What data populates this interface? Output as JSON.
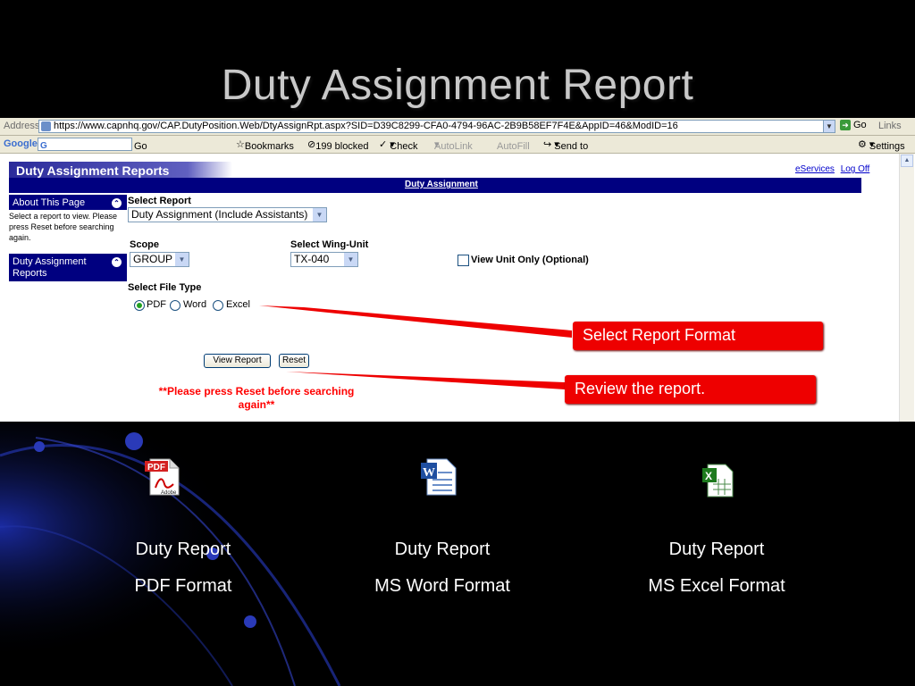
{
  "slide": {
    "title": "Duty Assignment Report"
  },
  "browser": {
    "address_label": "Address",
    "url": "https://www.capnhq.gov/CAP.DutyPosition.Web/DtyAssignRpt.aspx?SID=D39C8299-CFA0-4794-96AC-2B9B58EF7F4E&AppID=46&ModID=16",
    "go_label": "Go",
    "links_label": "Links",
    "google_label": "Google",
    "go_small": "Go",
    "bookmarks": "Bookmarks",
    "blocked": "199 blocked",
    "check": "Check",
    "autolink": "AutoLink",
    "autofill": "AutoFill",
    "send_to": "Send to",
    "settings": "Settings"
  },
  "page": {
    "header_title": "Duty Assignment Reports",
    "link_eservices": "eServices",
    "link_logoff": "Log Off",
    "bar_link": "Duty Assignment",
    "sidebar": {
      "about_title": "About This Page",
      "about_text": "Select a report to view. Please press Reset before searching again.",
      "reports_title": "Duty Assignment Reports"
    },
    "select_report_label": "Select Report",
    "select_report_value": "Duty Assignment (Include Assistants)",
    "scope_label": "Scope",
    "scope_value": "GROUP",
    "wing_label": "Select Wing-Unit",
    "wing_value": "TX-040",
    "view_unit_label": "View Unit Only (Optional)",
    "file_type_label": "Select File Type",
    "file_types": [
      "PDF",
      "Word",
      "Excel"
    ],
    "file_type_selected": "PDF",
    "view_report_button": "View Report",
    "reset_button": "Reset",
    "warning": "**Please press Reset before searching again**"
  },
  "callouts": {
    "format": "Select Report Format",
    "review": "Review the report."
  },
  "downloads": [
    {
      "title": "Duty Report",
      "format": "PDF Format",
      "icon": "pdf-file-icon"
    },
    {
      "title": "Duty Report",
      "format": "MS Word Format",
      "icon": "word-file-icon"
    },
    {
      "title": "Duty Report",
      "format": "MS Excel Format",
      "icon": "excel-file-icon"
    }
  ],
  "colors": {
    "callout": "#ee0000",
    "header_blue": "#000080",
    "title_gray": "#c8c8c8"
  }
}
